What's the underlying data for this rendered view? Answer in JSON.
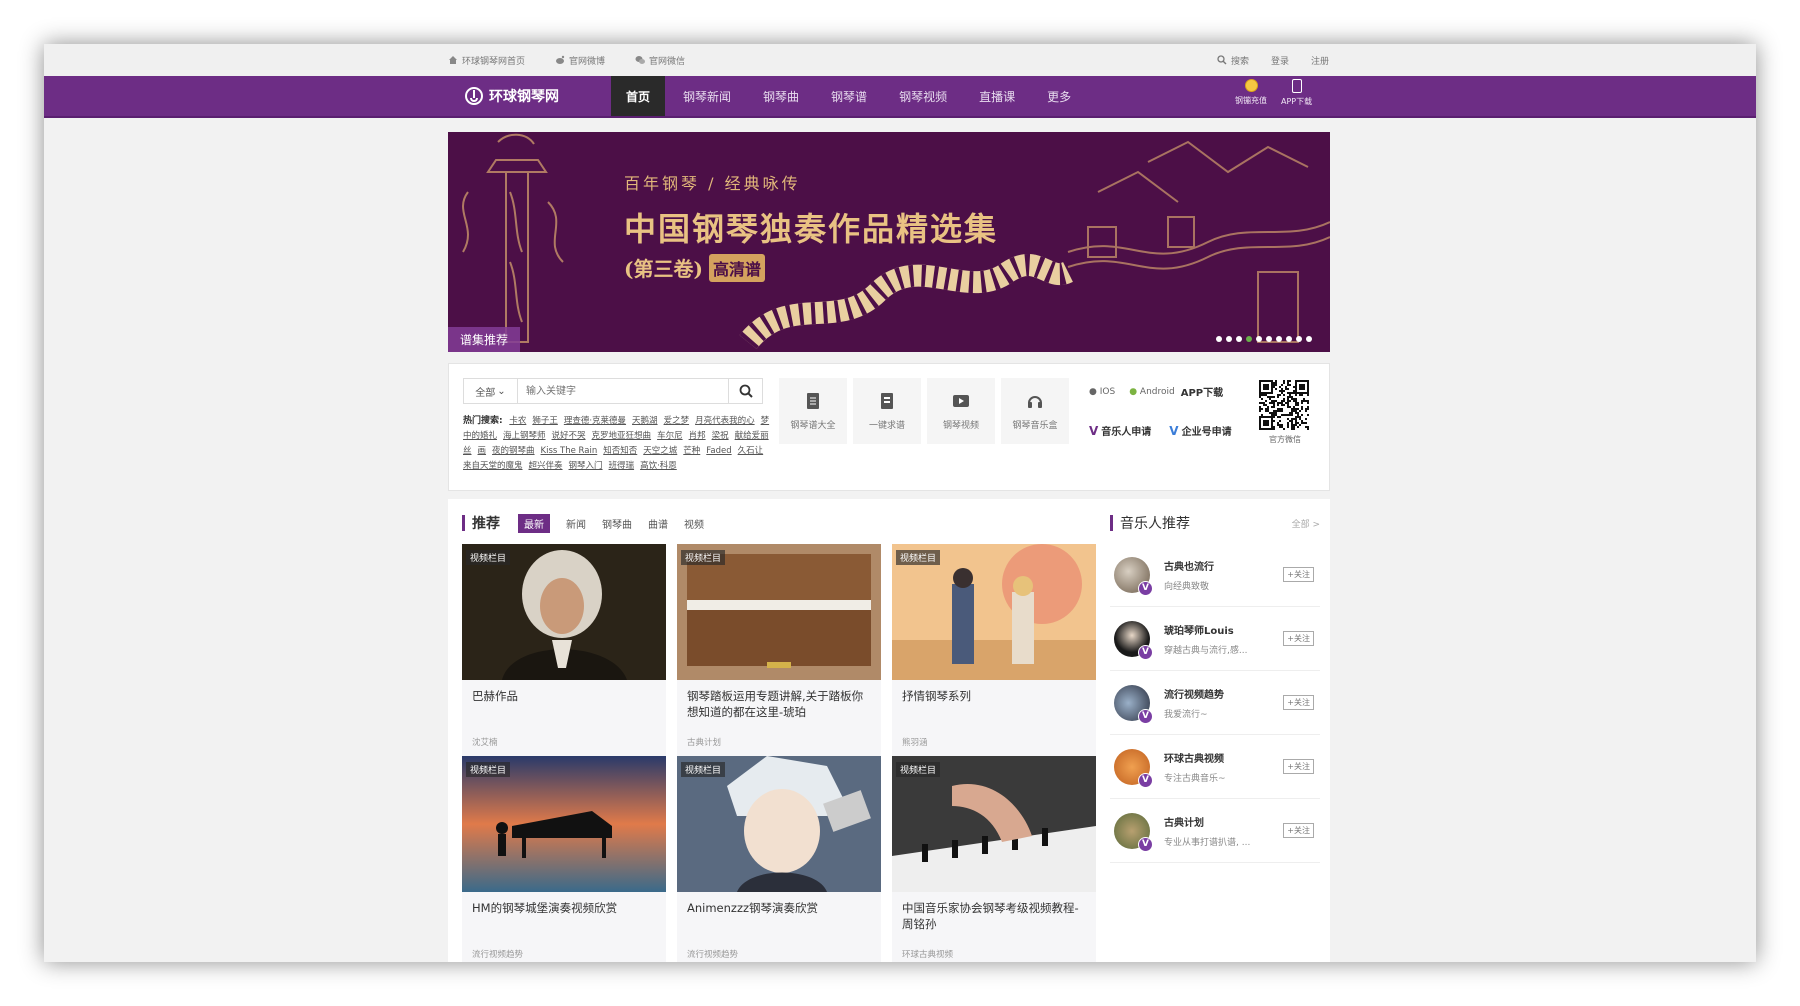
{
  "topbar": {
    "links": [
      {
        "label": "环球钢琴网首页",
        "icon": "home-icon"
      },
      {
        "label": "官网微博",
        "icon": "weibo-icon"
      },
      {
        "label": "官网微信",
        "icon": "wechat-icon"
      }
    ],
    "search_label": "搜索",
    "login_label": "登录",
    "register_label": "注册"
  },
  "nav": {
    "logo_text": "环球钢琴网",
    "items": [
      "首页",
      "钢琴新闻",
      "钢琴曲",
      "钢琴谱",
      "钢琴视频",
      "直播课",
      "更多"
    ],
    "active_index": 0,
    "recharge_label": "钢镚充值",
    "app_label": "APP下载",
    "accent": "#6d2d85"
  },
  "banner": {
    "subtitle": "百年钢琴 / 经典咏传",
    "title": "中国钢琴独奏作品精选集",
    "volume": "(第三卷)",
    "hd_badge": "高清谱",
    "tag": "谱集推荐",
    "dot_count": 10,
    "active_dot": 3
  },
  "search": {
    "category": "全部",
    "placeholder": "输入关键字",
    "hot_label": "热门搜索:",
    "hot_terms": [
      "卡农",
      "狮子王",
      "理查德·克莱德曼",
      "天鹅湖",
      "爱之梦",
      "月亮代表我的心",
      "梦中的婚礼",
      "海上钢琴师",
      "说好不哭",
      "克罗地亚狂想曲",
      "车尔尼",
      "肖邦",
      "梁祝",
      "献给爱丽丝",
      "画",
      "夜的钢琴曲",
      "Kiss The Rain",
      "知否知否",
      "天空之城",
      "芒种",
      "Faded",
      "久石让",
      "来自天堂的魔鬼",
      "超兴伴奏",
      "钢琴入门",
      "班得瑞",
      "高饮·科恩"
    ]
  },
  "tools": [
    {
      "label": "钢琴谱大全",
      "icon": "sheet-icon"
    },
    {
      "label": "一键求谱",
      "icon": "request-icon"
    },
    {
      "label": "钢琴视频",
      "icon": "video-icon"
    },
    {
      "label": "钢琴音乐盒",
      "icon": "headphones-icon"
    }
  ],
  "apps": {
    "ios": "IOS",
    "android": "Android",
    "download": "APP下载",
    "musician_apply": "音乐人申请",
    "company_apply": "企业号申请",
    "qr_label": "官方微信"
  },
  "recommend": {
    "title": "推荐",
    "tabs": [
      "最新",
      "新闻",
      "钢琴曲",
      "曲谱",
      "视频"
    ],
    "active_tab": 0,
    "cards": [
      {
        "tag": "视频栏目",
        "title": "巴赫作品",
        "author": "沈艾楠"
      },
      {
        "tag": "视频栏目",
        "title": "钢琴踏板运用专题讲解,关于踏板你想知道的都在这里-琥珀",
        "author": "古典计划"
      },
      {
        "tag": "视频栏目",
        "title": "抒情钢琴系列",
        "author": "熊羽涵"
      },
      {
        "tag": "视频栏目",
        "title": "HM的钢琴城堡演奏视频欣赏",
        "author": "流行视频趋势"
      },
      {
        "tag": "视频栏目",
        "title": "Animenzzz钢琴演奏欣赏",
        "author": "流行视频趋势"
      },
      {
        "tag": "视频栏目",
        "title": "中国音乐家协会钢琴考级视频教程-周铭孙",
        "author": "环球古典视频"
      }
    ]
  },
  "musicians": {
    "title": "音乐人推荐",
    "more": "全部 >",
    "follow_label": "+关注",
    "badge": "V",
    "items": [
      {
        "name": "古典也流行",
        "desc": "向经典致敬"
      },
      {
        "name": "琥珀琴师Louis",
        "desc": "穿越古典与流行,感..."
      },
      {
        "name": "流行视频趋势",
        "desc": "我爱流行~"
      },
      {
        "name": "环球古典视频",
        "desc": "专注古典音乐~"
      },
      {
        "name": "古典计划",
        "desc": "专业从事打谱扒谱, ..."
      }
    ]
  }
}
